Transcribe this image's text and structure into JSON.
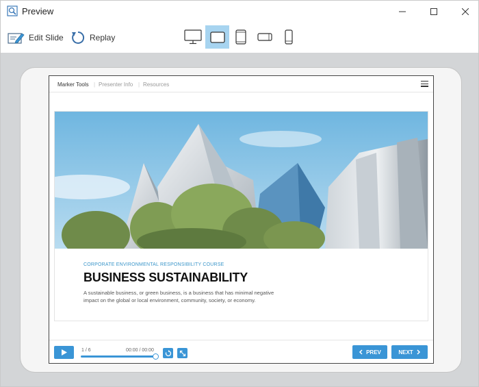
{
  "window": {
    "title": "Preview"
  },
  "toolbar": {
    "edit_label": "Edit Slide",
    "replay_label": "Replay",
    "devices": [
      "desktop",
      "tablet-landscape",
      "tablet-portrait",
      "phone-landscape",
      "phone-portrait"
    ],
    "active_device": "tablet-landscape"
  },
  "course": {
    "nav": {
      "marker_tools": "Marker Tools",
      "presenter_info": "Presenter Info",
      "resources": "Resources",
      "separator": "|"
    },
    "slide": {
      "eyebrow": "CORPORATE ENVIRONMENTAL RESPONSIBILITY COURSE",
      "title": "BUSINESS SUSTAINABILITY",
      "description": "A sustainable business, or green business, is a business that has minimal negative impact on the global or local environment, community, society, or economy."
    },
    "player": {
      "slide_count": "1 / 6",
      "time": "00:00 / 00:00",
      "progress": 1.0,
      "prev_label": "PREV",
      "next_label": "NEXT"
    }
  },
  "colors": {
    "accent": "#3a95d6",
    "active_device_bg": "#a7d4f0",
    "stage_bg": "#d3d5d7"
  }
}
